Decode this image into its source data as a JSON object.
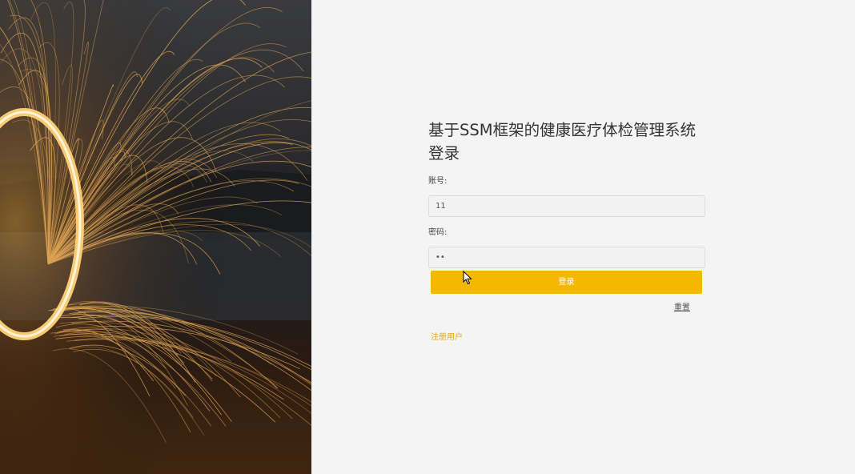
{
  "login": {
    "title": "基于SSM框架的健康医疗体检管理系统登录",
    "account_label": "账号:",
    "account_value": "11",
    "password_label": "密码:",
    "password_value": "••",
    "login_button": "登录",
    "reset_link": "重置",
    "register_link": "注册用户"
  },
  "colors": {
    "accent": "#f5b800",
    "register_link": "#e0a820",
    "panel_bg": "#f4f4f4"
  },
  "icons": {
    "cursor": "mouse-pointer-icon"
  }
}
